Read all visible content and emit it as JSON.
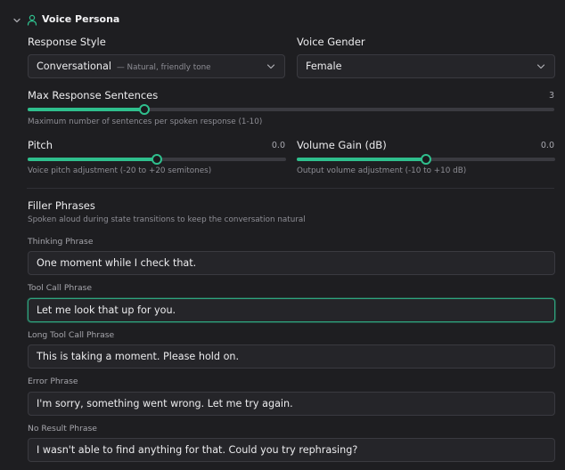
{
  "section": {
    "title": "Voice Persona"
  },
  "response_style": {
    "label": "Response Style",
    "value": "Conversational",
    "description": "— Natural, friendly tone"
  },
  "voice_gender": {
    "label": "Voice Gender",
    "value": "Female"
  },
  "max_sentences": {
    "label": "Max Response Sentences",
    "value": "3",
    "value_num": 3,
    "min": 1,
    "max": 10,
    "hint": "Maximum number of sentences per spoken response (1-10)"
  },
  "pitch": {
    "label": "Pitch",
    "value": "0.0",
    "value_num": 0,
    "min": -20,
    "max": 20,
    "hint": "Voice pitch adjustment (-20 to +20 semitones)"
  },
  "volume_gain": {
    "label": "Volume Gain (dB)",
    "value": "0.0",
    "value_num": 0,
    "min": -10,
    "max": 10,
    "hint": "Output volume adjustment (-10 to +10 dB)"
  },
  "filler": {
    "title": "Filler Phrases",
    "subtitle": "Spoken aloud during state transitions to keep the conversation natural",
    "thinking": {
      "label": "Thinking Phrase",
      "value": "One moment while I check that."
    },
    "tool_call": {
      "label": "Tool Call Phrase",
      "value": "Let me look that up for you."
    },
    "long_tool_call": {
      "label": "Long Tool Call Phrase",
      "value": "This is taking a moment. Please hold on."
    },
    "error": {
      "label": "Error Phrase",
      "value": "I'm sorry, something went wrong. Let me try again."
    },
    "no_result": {
      "label": "No Result Phrase",
      "value": "I wasn't able to find anything for that. Could you try rephrasing?"
    }
  },
  "colors": {
    "accent": "#2fbf8d",
    "background": "#1e1e21",
    "field": "#252529",
    "border": "#3a3a40"
  }
}
